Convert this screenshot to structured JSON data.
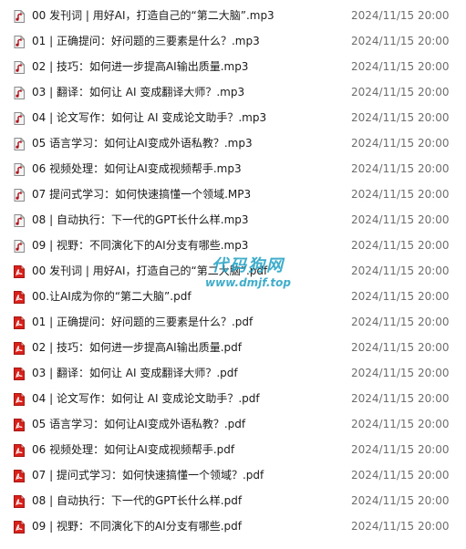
{
  "colors": {
    "mp3_icon_fill": "#f4f4f4",
    "mp3_icon_note": "#b0121b",
    "pdf_icon_fill": "#d9221c",
    "date_text": "#6d6d6d",
    "watermark": "#1f9fc2"
  },
  "files": [
    {
      "name": "00 发刊词 | 用好AI，打造自己的“第二大脑”.mp3",
      "date": "2024/11/15 20:00",
      "type": "mp3",
      "icon": "audio-file-icon"
    },
    {
      "name": "01 | 正确提问：好问题的三要素是什么？.mp3",
      "date": "2024/11/15 20:00",
      "type": "mp3",
      "icon": "audio-file-icon"
    },
    {
      "name": "02 | 技巧：如何进一步提高AI输出质量.mp3",
      "date": "2024/11/15 20:00",
      "type": "mp3",
      "icon": "audio-file-icon"
    },
    {
      "name": "03 | 翻译：如何让 AI 变成翻译大师？.mp3",
      "date": "2024/11/15 20:00",
      "type": "mp3",
      "icon": "audio-file-icon"
    },
    {
      "name": "04 | 论文写作：如何让 AI 变成论文助手？.mp3",
      "date": "2024/11/15 20:00",
      "type": "mp3",
      "icon": "audio-file-icon"
    },
    {
      "name": "05 语言学习：如何让AI变成外语私教？.mp3",
      "date": "2024/11/15 20:00",
      "type": "mp3",
      "icon": "audio-file-icon"
    },
    {
      "name": "06 视频处理：如何让AI变成视频帮手.mp3",
      "date": "2024/11/15 20:00",
      "type": "mp3",
      "icon": "audio-file-icon"
    },
    {
      "name": "07 提问式学习：如何快速搞懂一个领域.MP3",
      "date": "2024/11/15 20:00",
      "type": "mp3",
      "icon": "audio-file-icon"
    },
    {
      "name": "08 | 自动执行：下一代的GPT长什么样.mp3",
      "date": "2024/11/15 20:00",
      "type": "mp3",
      "icon": "audio-file-icon"
    },
    {
      "name": "09 | 视野：不同演化下的AI分支有哪些.mp3",
      "date": "2024/11/15 20:00",
      "type": "mp3",
      "icon": "audio-file-icon"
    },
    {
      "name": "00 发刊词 | 用好AI，打造自己的“第二大脑”.pdf",
      "date": "2024/11/15 20:00",
      "type": "pdf",
      "icon": "pdf-file-icon"
    },
    {
      "name": "00.让AI成为你的“第二大脑”.pdf",
      "date": "2024/11/15 20:00",
      "type": "pdf",
      "icon": "pdf-file-icon"
    },
    {
      "name": "01 | 正确提问：好问题的三要素是什么？.pdf",
      "date": "2024/11/15 20:00",
      "type": "pdf",
      "icon": "pdf-file-icon"
    },
    {
      "name": "02 | 技巧：如何进一步提高AI输出质量.pdf",
      "date": "2024/11/15 20:00",
      "type": "pdf",
      "icon": "pdf-file-icon"
    },
    {
      "name": "03 | 翻译：如何让 AI 变成翻译大师？.pdf",
      "date": "2024/11/15 20:00",
      "type": "pdf",
      "icon": "pdf-file-icon"
    },
    {
      "name": "04 | 论文写作：如何让 AI 变成论文助手？.pdf",
      "date": "2024/11/15 20:00",
      "type": "pdf",
      "icon": "pdf-file-icon"
    },
    {
      "name": "05 语言学习：如何让AI变成外语私教？.pdf",
      "date": "2024/11/15 20:00",
      "type": "pdf",
      "icon": "pdf-file-icon"
    },
    {
      "name": "06 视频处理：如何让AI变成视频帮手.pdf",
      "date": "2024/11/15 20:00",
      "type": "pdf",
      "icon": "pdf-file-icon"
    },
    {
      "name": "07 | 提问式学习：如何快速搞懂一个领域？.pdf",
      "date": "2024/11/15 20:00",
      "type": "pdf",
      "icon": "pdf-file-icon"
    },
    {
      "name": "08 | 自动执行：下一代的GPT长什么样.pdf",
      "date": "2024/11/15 20:00",
      "type": "pdf",
      "icon": "pdf-file-icon"
    },
    {
      "name": "09 | 视野：不同演化下的AI分支有哪些.pdf",
      "date": "2024/11/15 20:00",
      "type": "pdf",
      "icon": "pdf-file-icon"
    }
  ],
  "watermark": {
    "title": "代码狗网",
    "url": "www.dmjf.top"
  }
}
